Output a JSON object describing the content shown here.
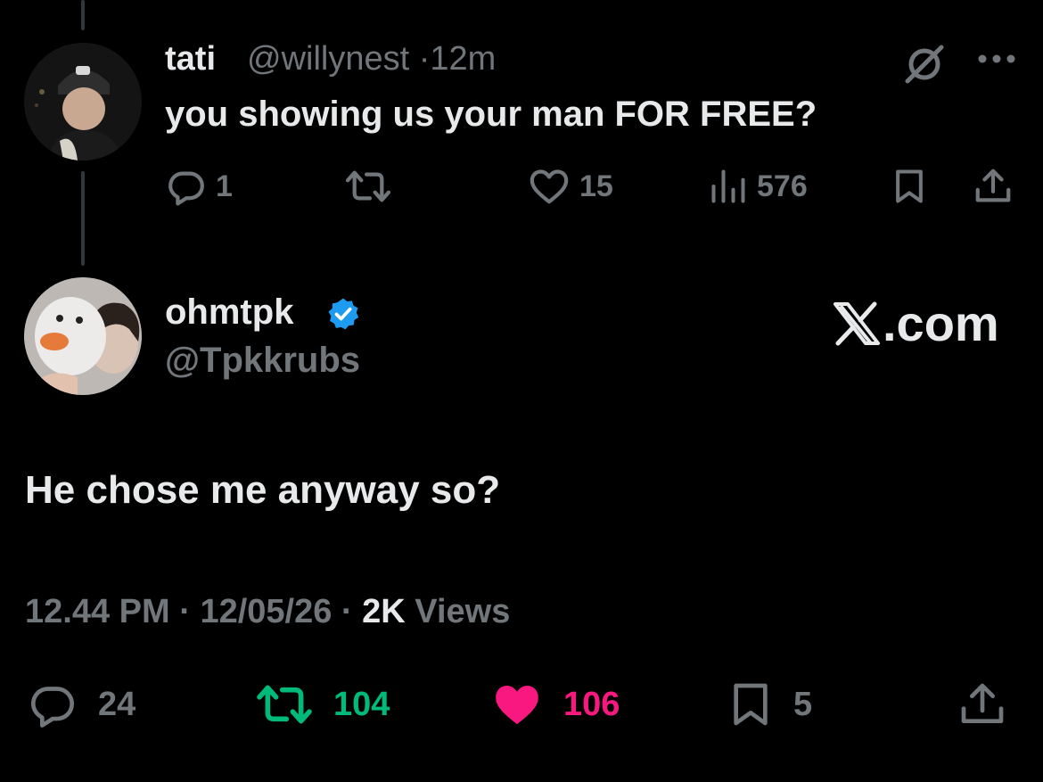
{
  "parent_tweet": {
    "display_name": "tati",
    "handle": "@willynest",
    "separator": "·",
    "time_ago": "12m",
    "text": "you showing us your man FOR FREE?",
    "replies": "1",
    "reposts": "",
    "likes": "15",
    "views": "576"
  },
  "main_tweet": {
    "display_name": "ohmtpk",
    "handle": "@Tpkkrubs",
    "text": "He chose me anyway so?",
    "time": "12.44 PM",
    "date": "12/05/26",
    "separator": "·",
    "views_count": "2K",
    "views_label": "Views",
    "replies": "24",
    "reposts": "104",
    "likes": "106",
    "bookmarks": "5"
  },
  "watermark": {
    "text": ".com"
  },
  "colors": {
    "background": "#000000",
    "text_primary": "#e7e9ea",
    "text_secondary": "#71767b",
    "repost_active": "#00ba7c",
    "like_active": "#f91880",
    "verified_badge": "#1d9bf0",
    "thread_line": "#333639"
  },
  "icons": {
    "parent_actions": [
      "reply-icon",
      "repost-icon",
      "like-icon",
      "views-icon",
      "bookmark-icon",
      "share-icon"
    ],
    "main_actions": [
      "reply-icon",
      "repost-icon",
      "like-filled-icon",
      "bookmark-icon",
      "share-icon"
    ]
  }
}
